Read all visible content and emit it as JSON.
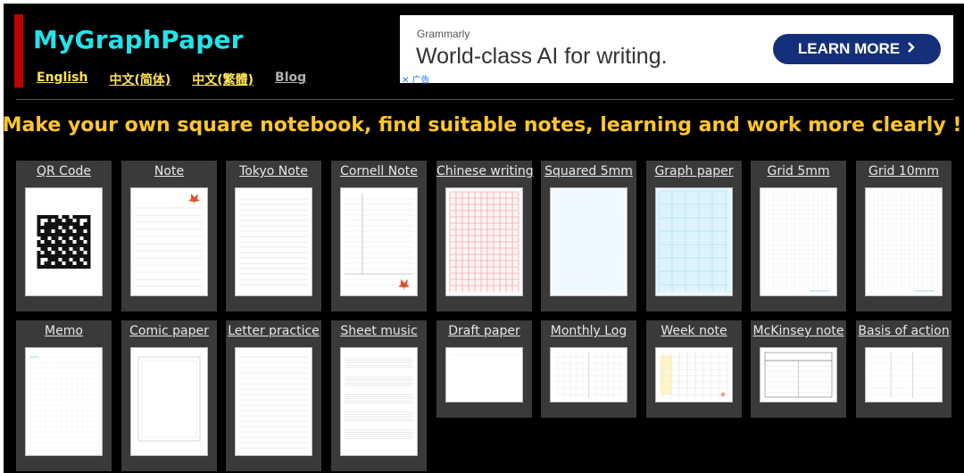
{
  "header": {
    "logo_text": "MyGraphPaper",
    "nav": [
      {
        "label": "English",
        "color": "yellow"
      },
      {
        "label": "中文(简体)",
        "color": "yellow"
      },
      {
        "label": "中文(繁體)",
        "color": "yellow"
      },
      {
        "label": "Blog",
        "color": "gray"
      }
    ]
  },
  "ad": {
    "brand": "Grammarly",
    "headline": "World-class AI for writing.",
    "button_label": "LEARN MORE",
    "close_label": "✕ 广告"
  },
  "main": {
    "headline": "Make your own square notebook, find suitable notes, learning and work more clearly !"
  },
  "templates": [
    {
      "label": "QR Code",
      "preview": "qr"
    },
    {
      "label": "Note",
      "preview": "lined-leaf"
    },
    {
      "label": "Tokyo Note",
      "preview": "lined"
    },
    {
      "label": "Cornell Note",
      "preview": "cornell"
    },
    {
      "label": "Chinese writing",
      "preview": "chinese"
    },
    {
      "label": "Squared 5mm",
      "preview": "squared"
    },
    {
      "label": "Graph paper",
      "preview": "graph"
    },
    {
      "label": "Grid 5mm",
      "preview": "grid-light"
    },
    {
      "label": "Grid 10mm",
      "preview": "grid-light"
    },
    {
      "label": "Memo",
      "preview": "memo"
    },
    {
      "label": "Comic paper",
      "preview": "comic"
    },
    {
      "label": "Letter practice",
      "preview": "letter"
    },
    {
      "label": "Sheet music",
      "preview": "music"
    },
    {
      "label": "Draft paper",
      "preview": "draft"
    },
    {
      "label": "Monthly Log",
      "preview": "monthly"
    },
    {
      "label": "Week note",
      "preview": "week"
    },
    {
      "label": "McKinsey note",
      "preview": "mckinsey"
    },
    {
      "label": "Basis of action",
      "preview": "basis"
    }
  ],
  "colors": {
    "background": "#000000",
    "logo": "#22e3ea",
    "headline": "#ffc72b",
    "nav_link": "#ffe25a",
    "card_bg": "#3a3a3a",
    "ad_button": "#15307a"
  }
}
